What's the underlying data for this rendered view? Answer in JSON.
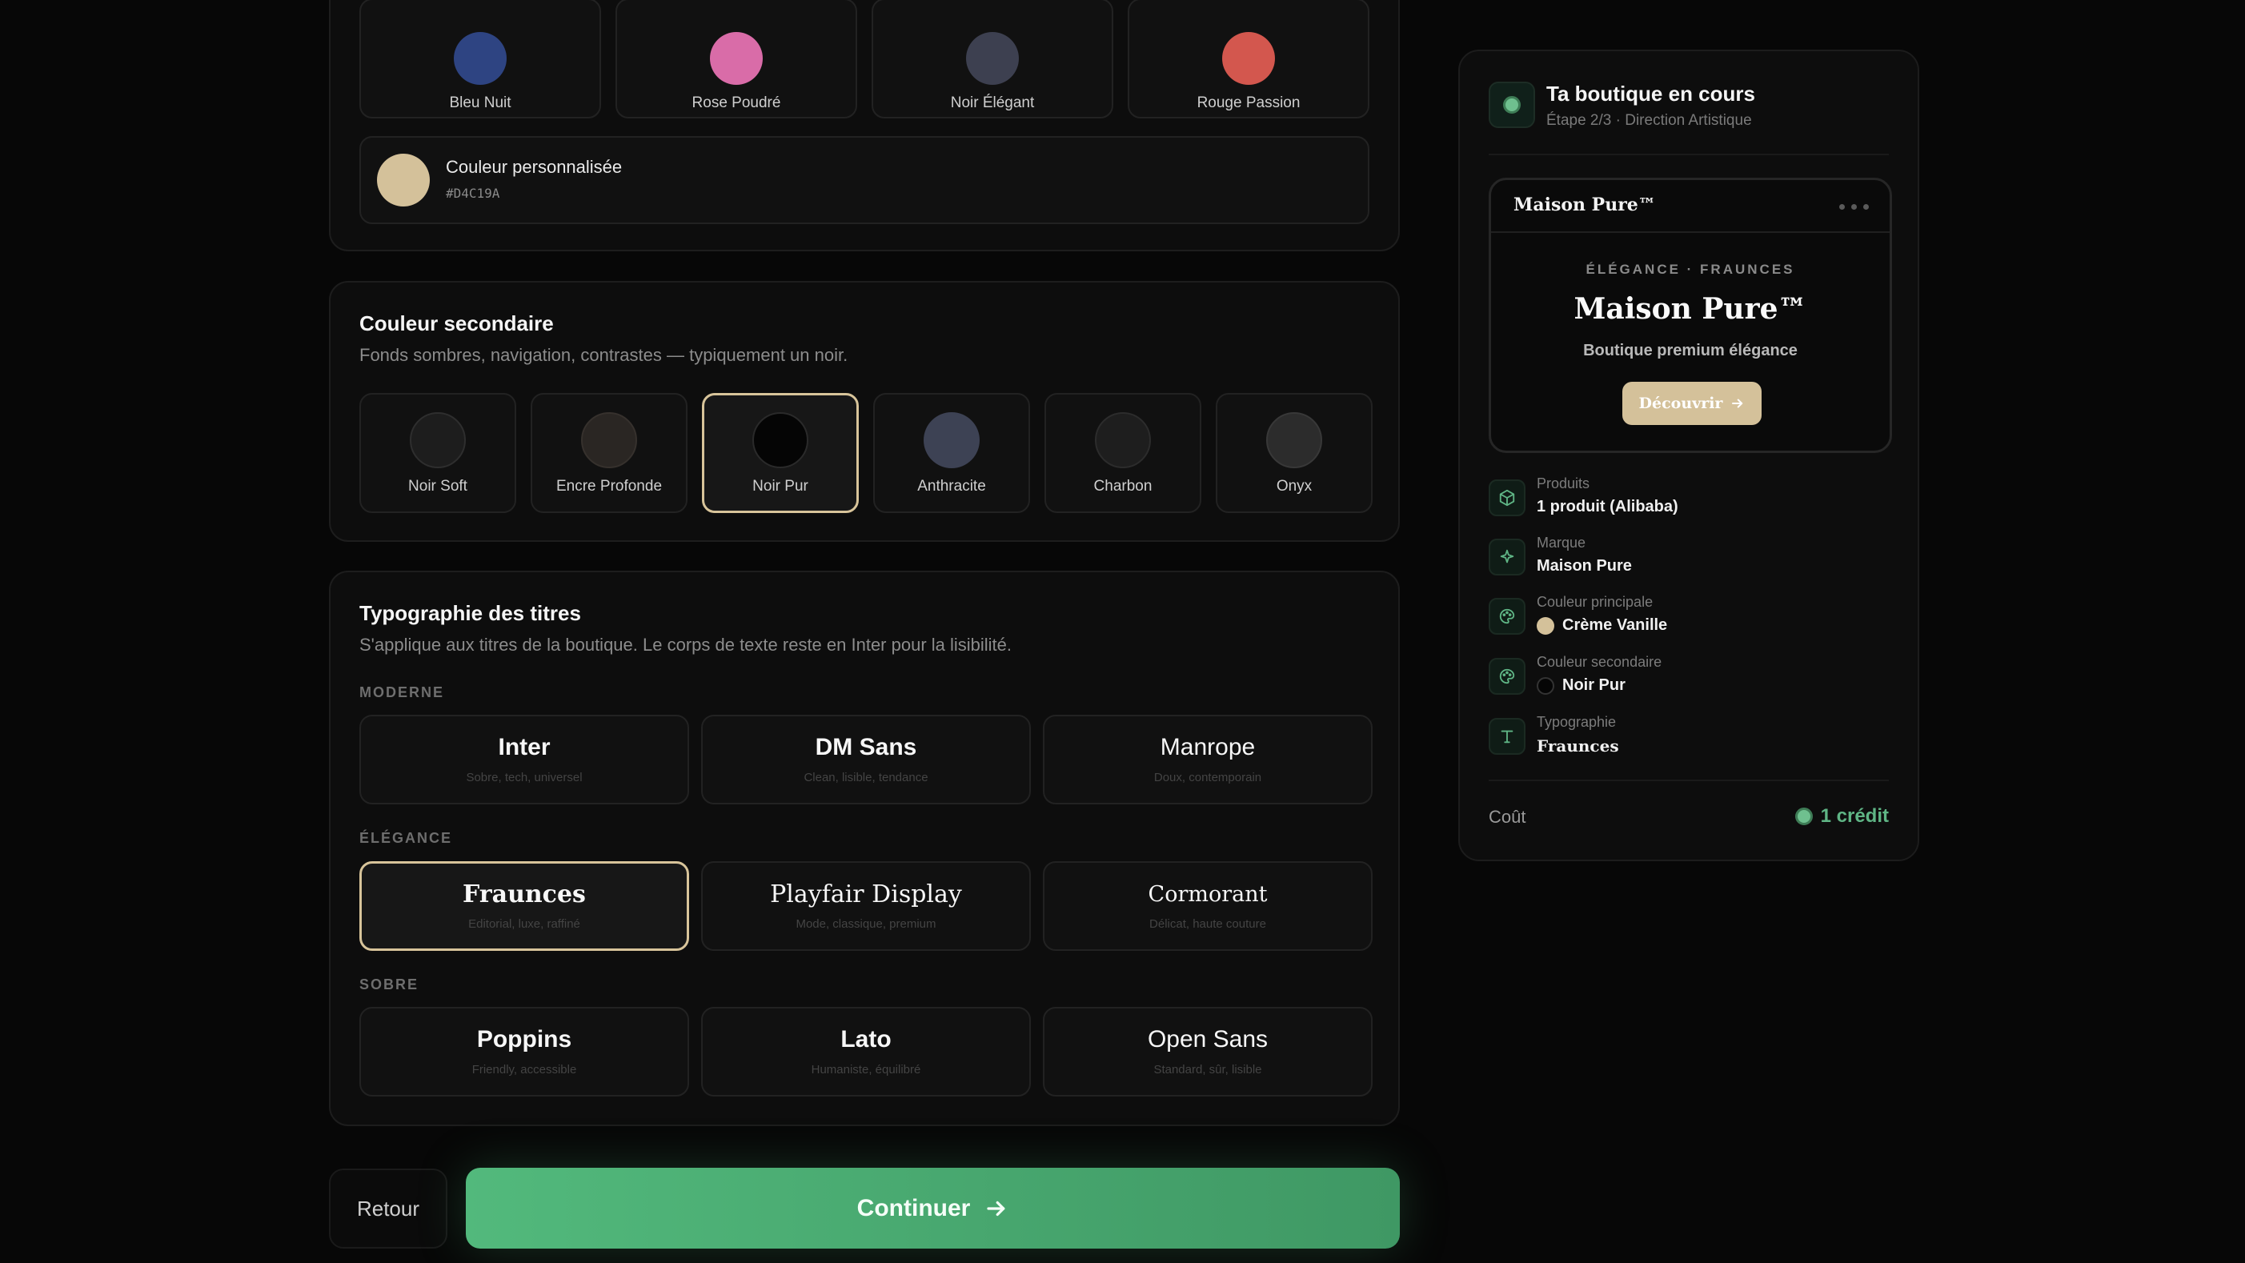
{
  "primary_colors": [
    {
      "label": "Bleu Nuit",
      "color": "#2e4482"
    },
    {
      "label": "Rose Poudré",
      "color": "#d96ca8"
    },
    {
      "label": "Noir Élégant",
      "color": "#3d4050"
    },
    {
      "label": "Rouge Passion",
      "color": "#d3574e"
    }
  ],
  "custom_color": {
    "label": "Couleur personnalisée",
    "hex": "#D4C19A",
    "color": "#d4c19a"
  },
  "secondary": {
    "title": "Couleur secondaire",
    "subtitle": "Fonds sombres, navigation, contrastes — typiquement un noir.",
    "options": [
      {
        "label": "Noir Soft",
        "color": "#1d1d1d"
      },
      {
        "label": "Encre Profonde",
        "color": "#2a2623"
      },
      {
        "label": "Noir Pur",
        "color": "#050505"
      },
      {
        "label": "Anthracite",
        "color": "#3d4254"
      },
      {
        "label": "Charbon",
        "color": "#1e1e1e"
      },
      {
        "label": "Onyx",
        "color": "#2c2c2c"
      }
    ],
    "selected": "Noir Pur"
  },
  "typography": {
    "title": "Typographie des titres",
    "subtitle": "S'applique aux titres de la boutique. Le corps de texte reste en Inter pour la lisibilité.",
    "groups": [
      {
        "tag": "MODERNE",
        "fonts": [
          {
            "name": "Inter",
            "desc": "Sobre, tech, universel"
          },
          {
            "name": "DM Sans",
            "desc": "Clean, lisible, tendance"
          },
          {
            "name": "Manrope",
            "desc": "Doux, contemporain"
          }
        ]
      },
      {
        "tag": "ÉLÉGANCE",
        "fonts": [
          {
            "name": "Fraunces",
            "desc": "Editorial, luxe, raffiné"
          },
          {
            "name": "Playfair Display",
            "desc": "Mode, classique, premium"
          },
          {
            "name": "Cormorant",
            "desc": "Délicat, haute couture"
          }
        ]
      },
      {
        "tag": "SOBRE",
        "fonts": [
          {
            "name": "Poppins",
            "desc": "Friendly, accessible"
          },
          {
            "name": "Lato",
            "desc": "Humaniste, équilibré"
          },
          {
            "name": "Open Sans",
            "desc": "Standard, sûr, lisible"
          }
        ]
      }
    ],
    "selected": "Fraunces"
  },
  "actions": {
    "back": "Retour",
    "continue": "Continuer"
  },
  "panel": {
    "title": "Ta boutique en cours",
    "subtitle": "Étape 2/3 · Direction Artistique",
    "preview": {
      "brand": "Maison Pure™",
      "eyebrow": "ÉLÉGANCE · FRAUNCES",
      "heading": "Maison Pure™",
      "tagline": "Boutique premium élégance",
      "cta": "Découvrir"
    },
    "info": [
      {
        "label": "Produits",
        "value": "1 produit (Alibaba)",
        "icon": "box-icon"
      },
      {
        "label": "Marque",
        "value": "Maison Pure",
        "icon": "sparkle-icon"
      },
      {
        "label": "Couleur principale",
        "value": "Crème Vanille",
        "icon": "palette-icon",
        "color": "#d4c19a"
      },
      {
        "label": "Couleur secondaire",
        "value": "Noir Pur",
        "icon": "palette-icon",
        "color": "#050505"
      },
      {
        "label": "Typographie",
        "value": "Fraunces",
        "icon": "type-icon"
      }
    ],
    "cost_label": "Coût",
    "cost_value": "1 crédit",
    "accent": "#5fb585"
  }
}
